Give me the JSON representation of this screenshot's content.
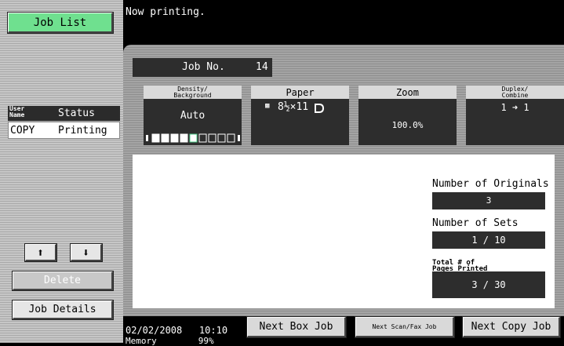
{
  "left": {
    "job_list": "Job List",
    "col_user": "User Name",
    "col_status": "Status",
    "row": {
      "user": "COPY",
      "status": "Printing"
    },
    "delete": "Delete",
    "job_details": "Job Details"
  },
  "status_message": "Now printing.",
  "job": {
    "no_label": "Job No.",
    "no_value": "14"
  },
  "tiles": {
    "density": {
      "header": "Density/ Background",
      "value": "Auto",
      "level": 5,
      "levels": 9
    },
    "paper": {
      "header": "Paper",
      "value": "8½×11"
    },
    "zoom": {
      "header": "Zoom",
      "value": "100.0%"
    },
    "duplex": {
      "header": "Duplex/ Combine",
      "value": "1 ➜ 1"
    }
  },
  "counts": {
    "originals_label": "Number of Originals",
    "originals_value": "3",
    "sets_label": "Number of Sets",
    "sets_value": "1 / 10",
    "pages_label": "Total # of Pages Printed",
    "pages_value": "3 / 30"
  },
  "footer": {
    "datetime": "02/02/2008   10:10",
    "memory": "Memory        99%",
    "next_box": "Next Box Job",
    "next_scan": "Next Scan/Fax Job",
    "next_copy": "Next Copy Job"
  }
}
